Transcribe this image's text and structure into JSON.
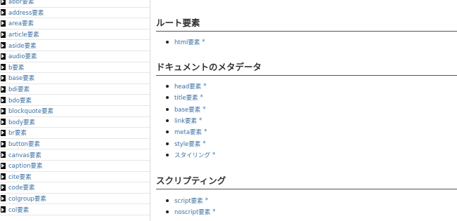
{
  "sidebar": {
    "items": [
      {
        "label": "abbr要素"
      },
      {
        "label": "address要素"
      },
      {
        "label": "area要素"
      },
      {
        "label": "article要素"
      },
      {
        "label": "aside要素"
      },
      {
        "label": "audio要素"
      },
      {
        "label": "b要素"
      },
      {
        "label": "base要素"
      },
      {
        "label": "bdi要素"
      },
      {
        "label": "bdo要素"
      },
      {
        "label": "blockquote要素"
      },
      {
        "label": "body要素"
      },
      {
        "label": "br要素"
      },
      {
        "label": "button要素"
      },
      {
        "label": "canvas要素"
      },
      {
        "label": "caption要素"
      },
      {
        "label": "cite要素"
      },
      {
        "label": "code要素"
      },
      {
        "label": "colgroup要素"
      },
      {
        "label": "col要素"
      }
    ]
  },
  "main": {
    "top_text": "",
    "sections": [
      {
        "heading": "ルート要素",
        "items": [
          {
            "label": "html要素",
            "star": "*"
          }
        ]
      },
      {
        "heading": "ドキュメントのメタデータ",
        "items": [
          {
            "label": "head要素",
            "star": "*"
          },
          {
            "label": "title要素",
            "star": "*"
          },
          {
            "label": "base要素",
            "star": "*"
          },
          {
            "label": "link要素",
            "star": "*"
          },
          {
            "label": "meta要素",
            "star": "*"
          },
          {
            "label": "style要素",
            "star": "*"
          },
          {
            "label": "スタイリング",
            "star": "*"
          }
        ]
      },
      {
        "heading": "スクリプティング",
        "items": [
          {
            "label": "script要素",
            "star": "*"
          },
          {
            "label": "noscript要素",
            "star": "*"
          }
        ]
      }
    ]
  },
  "colors": {
    "link": "#3a6fa0",
    "heading": "#333333",
    "arrow": "#111111"
  }
}
